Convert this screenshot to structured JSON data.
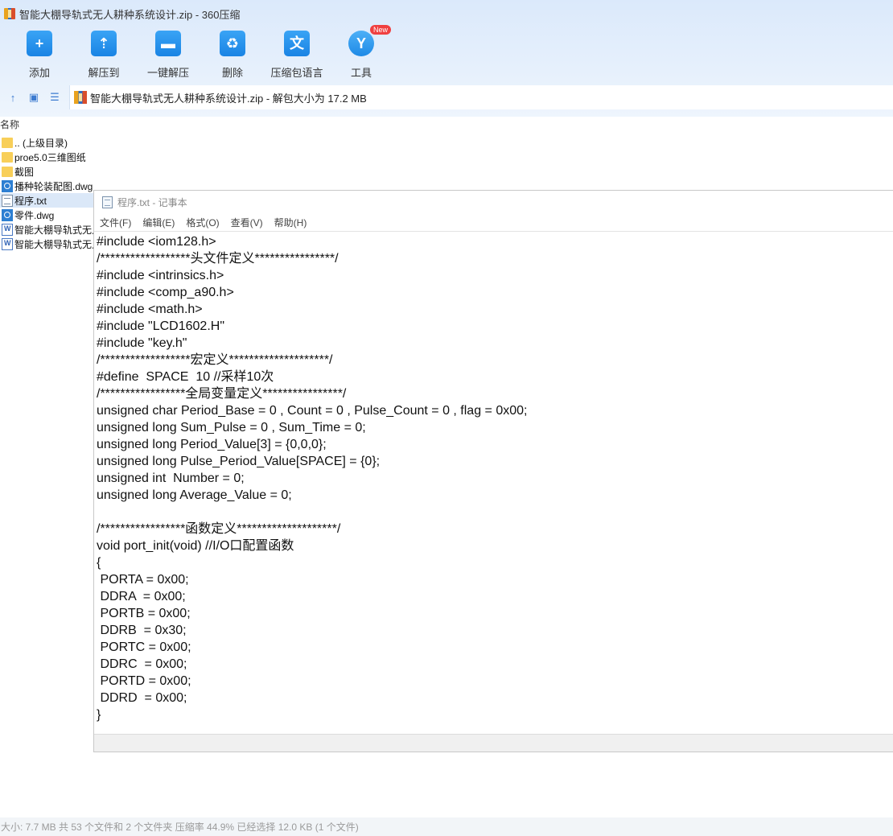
{
  "window": {
    "title": "智能大棚导轨式无人耕种系统设计.zip - 360压缩"
  },
  "toolbar": {
    "buttons": [
      {
        "label": "添加",
        "icon": "add-icon",
        "glyph": "+"
      },
      {
        "label": "解压到",
        "icon": "extract-to-icon",
        "glyph": "⇡"
      },
      {
        "label": "一键解压",
        "icon": "one-click-extract-icon",
        "glyph": "▬"
      },
      {
        "label": "删除",
        "icon": "delete-icon",
        "glyph": "♻"
      },
      {
        "label": "压缩包语言",
        "icon": "language-icon",
        "glyph": "文"
      },
      {
        "label": "工具",
        "icon": "tools-icon",
        "glyph": "Y",
        "badge": "New"
      }
    ]
  },
  "pathbar": {
    "text": "智能大棚导轨式无人耕种系统设计.zip - 解包大小为 17.2 MB"
  },
  "file_list": {
    "column_header": "名称",
    "items": [
      {
        "name": ".. (上级目录)",
        "type": "folder"
      },
      {
        "name": "proe5.0三维图纸",
        "type": "folder"
      },
      {
        "name": "截图",
        "type": "folder"
      },
      {
        "name": "播种轮装配图.dwg",
        "type": "dwg"
      },
      {
        "name": "程序.txt",
        "type": "txt",
        "selected": true
      },
      {
        "name": "零件.dwg",
        "type": "dwg"
      },
      {
        "name": "智能大棚导轨式无人",
        "type": "doc"
      },
      {
        "name": "智能大棚导轨式无人",
        "type": "doc"
      }
    ]
  },
  "notepad": {
    "title": "程序.txt - 记事本",
    "menus": [
      "文件(F)",
      "编辑(E)",
      "格式(O)",
      "查看(V)",
      "帮助(H)"
    ],
    "content": "#include <iom128.h>\n/******************头文件定义****************/\n#include <intrinsics.h>\n#include <comp_a90.h>\n#include <math.h>\n#include \"LCD1602.H\"\n#include \"key.h\"\n/******************宏定义********************/\n#define  SPACE  10 //采样10次\n/*****************全局变量定义****************/\nunsigned char Period_Base = 0 , Count = 0 , Pulse_Count = 0 , flag = 0x00;\nunsigned long Sum_Pulse = 0 , Sum_Time = 0;\nunsigned long Period_Value[3] = {0,0,0};\nunsigned long Pulse_Period_Value[SPACE] = {0};\nunsigned int  Number = 0;\nunsigned long Average_Value = 0;\n\n/*****************函数定义********************/\nvoid port_init(void) //I/O口配置函数\n{\n PORTA = 0x00;\n DDRA  = 0x00;\n PORTB = 0x00;\n DDRB  = 0x30;\n PORTC = 0x00;\n DDRC  = 0x00;\n PORTD = 0x00;\n DDRD  = 0x00;\n}"
  },
  "status": {
    "text": "大小: 7.7 MB 共 53 个文件和 2 个文件夹 压缩率 44.9% 已经选择 12.0 KB (1 个文件)"
  }
}
